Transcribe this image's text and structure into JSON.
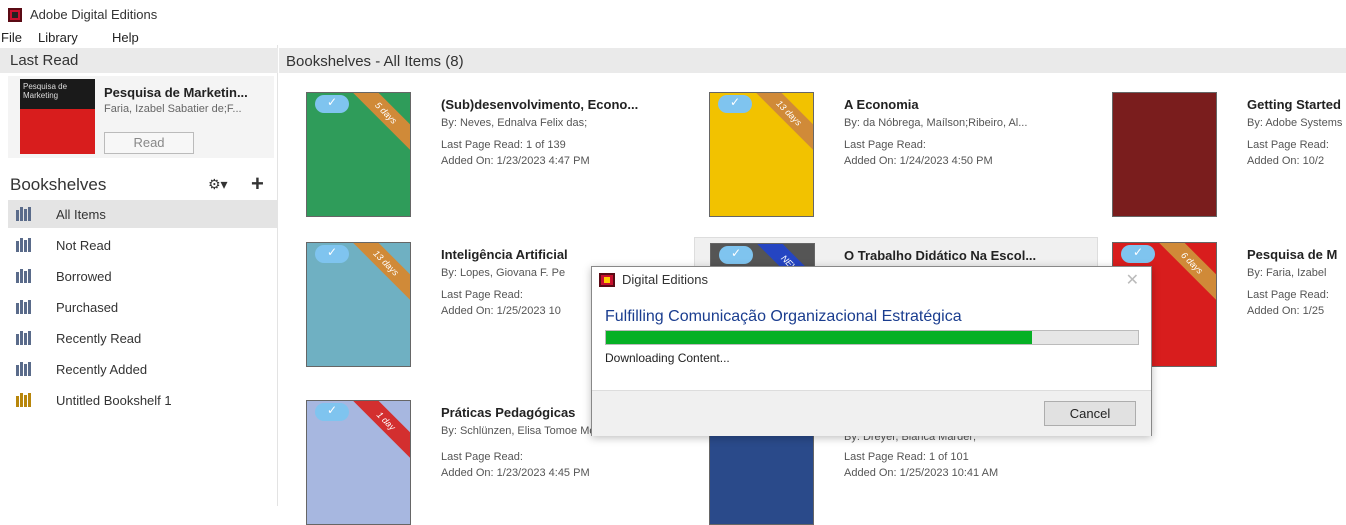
{
  "window": {
    "title": "Adobe Digital Editions"
  },
  "menu": {
    "file": "File",
    "library": "Library",
    "help": "Help"
  },
  "last_read": {
    "header": "Last Read",
    "title": "Pesquisa de Marketin...",
    "author": "Faria, Izabel Sabatier de;F...",
    "read_button": "Read",
    "cover_text": "Pesquisa de Marketing"
  },
  "bookshelves": {
    "header": "Bookshelves",
    "items": [
      {
        "label": "All Items"
      },
      {
        "label": "Not Read"
      },
      {
        "label": "Borrowed"
      },
      {
        "label": "Purchased"
      },
      {
        "label": "Recently Read"
      },
      {
        "label": "Recently Added"
      },
      {
        "label": "Untitled Bookshelf 1"
      }
    ]
  },
  "main": {
    "header": "Bookshelves - All Items (8)"
  },
  "books": [
    {
      "title": "(Sub)desenvolvimento, Econo...",
      "by": "By:  Neves, Ednalva Felix das;",
      "last_page": "Last Page Read:  1 of 139",
      "added": "Added On:  1/23/2023 4:47 PM",
      "badge": "5 days",
      "cover_color": "#2f9c5a"
    },
    {
      "title": "A Economia",
      "by": "By:  da Nóbrega, Maílson;Ribeiro, Al...",
      "last_page": "Last Page Read:",
      "added": "Added On:  1/24/2023 4:50 PM",
      "badge": "13 days",
      "cover_color": "#f2c200"
    },
    {
      "title": "Getting Started",
      "by": "By:  Adobe Systems",
      "last_page": "Last Page Read:",
      "added": "Added On:  10/2",
      "badge": "",
      "cover_color": "#7a1d1d"
    },
    {
      "title": "Inteligência Artificial",
      "by": "By:  Lopes, Giovana F. Pe",
      "last_page": "Last Page Read:",
      "added": "Added On:  1/25/2023 10",
      "badge": "13 days",
      "cover_color": "#6fb0c2"
    },
    {
      "title": "O Trabalho Didático Na Escol...",
      "by": "",
      "last_page": "",
      "added": "",
      "badge": "NEW",
      "cover_color": "#555555"
    },
    {
      "title": "Pesquisa de M",
      "by": "By:  Faria, Izabel",
      "last_page": "Last Page Read:",
      "added": "Added On:  1/25",
      "badge": "6 days",
      "cover_color": "#d81d1d"
    },
    {
      "title": "Práticas Pedagógicas",
      "by": "By:  Schlünzen, Elisa Tomoe Moria,Sa...",
      "last_page": "Last Page Read:",
      "added": "Added On:  1/23/2023 4:45 PM",
      "badge": "1 day",
      "cover_color": "#a7b7e0"
    },
    {
      "title": "",
      "by": "By:  Dreyer, Bianca Marder;",
      "last_page": "Last Page Read:  1 of 101",
      "added": "Added On:  1/25/2023 10:41 AM",
      "badge": "",
      "cover_color": "#2a4a8a"
    }
  ],
  "dialog": {
    "title": "Digital Editions",
    "heading": "Fulfilling Comunicação Organizacional Estratégica",
    "status": "Downloading Content...",
    "cancel": "Cancel",
    "progress": 0.8
  }
}
